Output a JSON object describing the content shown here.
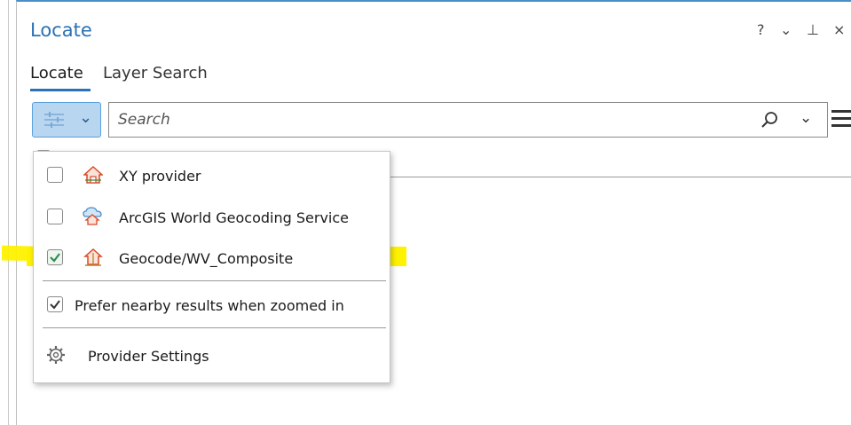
{
  "pane": {
    "title": "Locate",
    "controls": {
      "help": "?",
      "options": "⌄",
      "pin": "⊥",
      "close": "×"
    }
  },
  "tabs": [
    {
      "label": "Locate",
      "active": true
    },
    {
      "label": "Layer Search",
      "active": false
    }
  ],
  "search": {
    "placeholder": "Search",
    "value": ""
  },
  "dropdown": {
    "providers": [
      {
        "label": "XY provider",
        "checked": false,
        "icon": "house-icon"
      },
      {
        "label": "ArcGIS World Geocoding Service",
        "checked": false,
        "icon": "cloud-house-icon"
      },
      {
        "label": "Geocode/WV_Composite",
        "checked": true,
        "icon": "locator-house-icon"
      }
    ],
    "prefer_nearby": {
      "label": "Prefer nearby results when zoomed in",
      "checked": true
    },
    "settings": {
      "label": "Provider Settings",
      "icon": "gear-icon"
    }
  },
  "colors": {
    "accent": "#2a72b5",
    "button_bg": "#b9d6f1",
    "highlight": "#fff200",
    "house_red": "#d8492b",
    "checked_green": "#2e8b57"
  }
}
